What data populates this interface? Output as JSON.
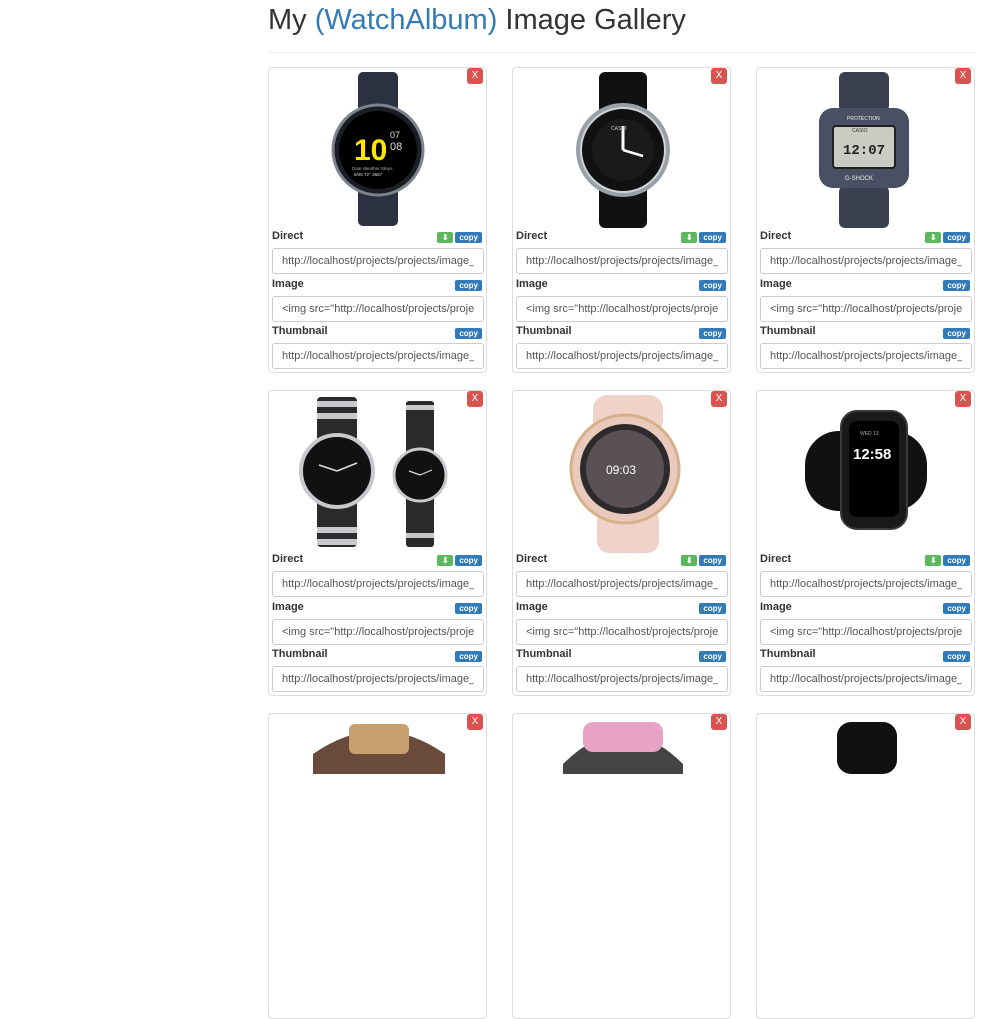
{
  "header": {
    "title_prefix": "My",
    "album": "(WatchAlbum)",
    "title_suffix": "Image Gallery"
  },
  "labels": {
    "direct": "Direct",
    "image": "Image",
    "thumbnail": "Thumbnail",
    "copy": "copy",
    "delete": "X"
  },
  "cards": [
    {
      "direct": "http://localhost/projects/projects/image_",
      "image": "<img src=\"http://localhost/projects/projects/image_",
      "thumbnail": "http://localhost/projects/projects/image_"
    },
    {
      "direct": "http://localhost/projects/projects/image_",
      "image": "<img src=\"http://localhost/projects/projects/image_",
      "thumbnail": "http://localhost/projects/projects/image_"
    },
    {
      "direct": "http://localhost/projects/projects/image_",
      "image": "<img src=\"http://localhost/projects/projects/image_",
      "thumbnail": "http://localhost/projects/projects/image_"
    },
    {
      "direct": "http://localhost/projects/projects/image_",
      "image": "<img src=\"http://localhost/projects/projects/image_",
      "thumbnail": "http://localhost/projects/projects/image_"
    },
    {
      "direct": "http://localhost/projects/projects/image_",
      "image": "<img src=\"http://localhost/projects/projects/image_",
      "thumbnail": "http://localhost/projects/projects/image_"
    },
    {
      "direct": "http://localhost/projects/projects/image_",
      "image": "<img src=\"http://localhost/projects/projects/image_",
      "thumbnail": "http://localhost/projects/projects/image_"
    }
  ],
  "watch_faces": {
    "w1": {
      "hour": "10",
      "min": "08",
      "small": "07",
      "row": "Date   Weather   Steps",
      "vals": "6/05   72°   3657"
    },
    "w3": {
      "brand": "CASIO",
      "model": "G-SHOCK",
      "top": "PROTECTION",
      "time": "12:07"
    },
    "w5": {
      "time": "09:03"
    },
    "w6": {
      "time": "12:58",
      "date": "WED 13"
    },
    "w2": {
      "brand": "CASIO"
    }
  },
  "colors": {
    "accent": "#337ab7",
    "danger": "#d9534f",
    "success": "#5cb85c"
  }
}
